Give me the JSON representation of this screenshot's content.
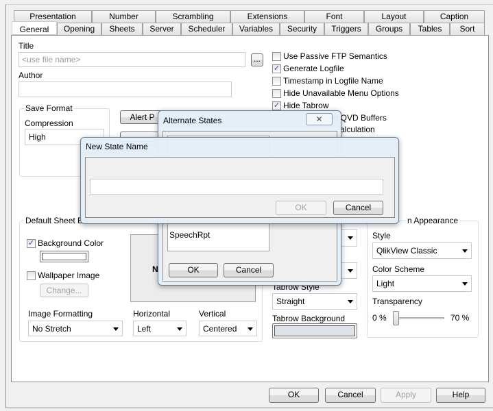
{
  "tabs_row1": [
    "Presentation",
    "Number",
    "Scrambling",
    "Extensions",
    "Font",
    "Layout",
    "Caption"
  ],
  "tabs_row2": [
    "General",
    "Opening",
    "Sheets",
    "Server",
    "Scheduler",
    "Variables",
    "Security",
    "Triggers",
    "Groups",
    "Tables",
    "Sort"
  ],
  "selected_tab": "General",
  "title": {
    "label": "Title",
    "placeholder": "<use file name>",
    "browse": "..."
  },
  "author": {
    "label": "Author",
    "value": ""
  },
  "options": [
    {
      "label": "Use Passive FTP Semantics",
      "checked": false
    },
    {
      "label": "Generate Logfile",
      "checked": true
    },
    {
      "label": "Timestamp in Logfile Name",
      "checked": false
    },
    {
      "label": "Hide Unavailable Menu Options",
      "checked": false
    },
    {
      "label": "Hide Tabrow",
      "checked": true
    }
  ],
  "obscured_options": [
    "ed QVD Buffers",
    "alculation"
  ],
  "save_format": {
    "legend": "Save Format",
    "compression_label": "Compression",
    "compression": "High"
  },
  "alert_button": "Alert P",
  "background": {
    "legend": "Default Sheet Ba",
    "bg_color": "Background Color",
    "bg_checked": true,
    "wallpaper": "Wallpaper Image",
    "wallpaper_checked": false,
    "change": "Change...",
    "preview_text": "N",
    "image_formatting_label": "Image Formatting",
    "image_formatting": "No Stretch",
    "horizontal_label": "Horizontal",
    "horizontal": "Left",
    "vertical_label": "Vertical",
    "vertical": "Centered"
  },
  "tabrow": {
    "style_label": "Tabrow Style",
    "style": "Straight",
    "background_label": "Tabrow Background",
    "background_color": "#dde3e8"
  },
  "appearance": {
    "legend": "n Appearance",
    "style_label": "Style",
    "style": "QlikView Classic",
    "scheme_label": "Color Scheme",
    "scheme": "Light",
    "transparency_label": "Transparency",
    "min": "0 %",
    "max": "70 %",
    "transparency_value": 0
  },
  "footer": {
    "ok": "OK",
    "cancel": "Cancel",
    "apply": "Apply",
    "help": "Help"
  },
  "alt_states": {
    "title": "Alternate States",
    "items": [
      "SpeechRpt"
    ],
    "ok": "OK",
    "cancel": "Cancel"
  },
  "new_state": {
    "title": "New State Name",
    "value": "",
    "ok": "OK",
    "cancel": "Cancel"
  }
}
